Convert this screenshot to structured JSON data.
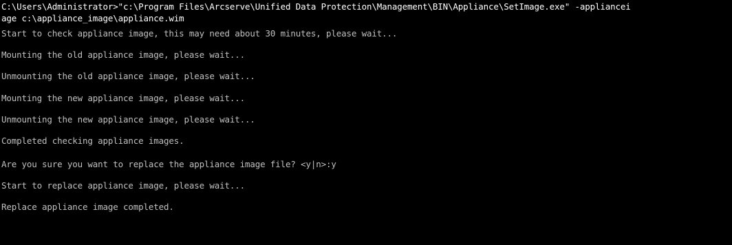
{
  "console": {
    "lines": [
      "C:\\Users\\Administrator>\"c:\\Program Files\\Arcserve\\Unified Data Protection\\Management\\BIN\\Appliance\\SetImage.exe\" -appliancei",
      "age c:\\appliance_image\\appliance.wim",
      "Start to check appliance image, this may need about 30 minutes, please wait...",
      "Mounting the old appliance image, please wait...",
      "Unmounting the old appliance image, please wait...",
      "Mounting the new appliance image, please wait...",
      "Unmounting the new appliance image, please wait...",
      "Completed checking appliance images.",
      "Are you sure you want to replace the appliance image file? <y|n>:y",
      "Start to replace appliance image, please wait...",
      "Replace appliance image completed."
    ]
  },
  "colors": {
    "background": "#000000",
    "text": "#c0c0c0",
    "command_text": "#ffffff"
  }
}
